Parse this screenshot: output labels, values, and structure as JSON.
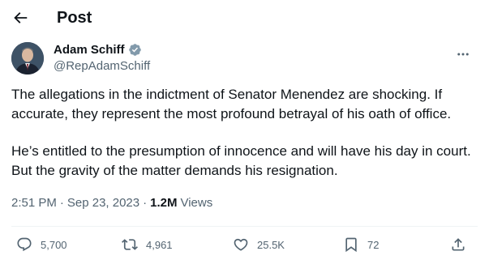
{
  "header": {
    "title": "Post"
  },
  "author": {
    "display_name": "Adam Schiff",
    "handle": "@RepAdamSchiff"
  },
  "tweet": {
    "paragraphs": [
      "The allegations in the indictment of Senator Menendez are shocking. If accurate, they represent the most profound betrayal of his oath of office.",
      "He’s entitled to the presumption of innocence and will have his day in court. But the gravity of the matter demands his resignation."
    ]
  },
  "meta": {
    "time": "2:51 PM",
    "separator": "·",
    "date": "Sep 23, 2023",
    "views_count": "1.2M",
    "views_label": "Views"
  },
  "actions": {
    "replies": "5,700",
    "reposts": "4,961",
    "likes": "25.5K",
    "bookmarks": "72"
  },
  "colors": {
    "text": "#0f1419",
    "secondary": "#536471",
    "verified": "#829aab",
    "divider": "#eff3f4"
  },
  "icons": [
    "back-arrow-icon",
    "verified-badge-icon",
    "more-icon",
    "reply-icon",
    "repost-icon",
    "like-icon",
    "bookmark-icon",
    "share-icon"
  ]
}
